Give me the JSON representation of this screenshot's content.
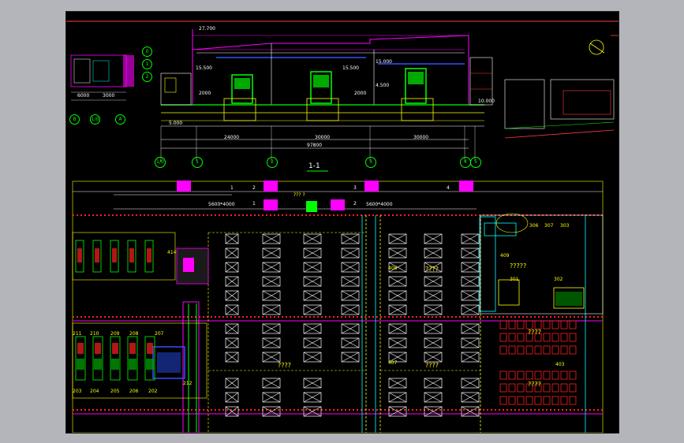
{
  "colors": {
    "background": "#000000",
    "frame": "#b3b5ba",
    "green": "#00ff00",
    "yellow": "#ffff00",
    "magenta": "#ff00ff",
    "cyan": "#00ffff",
    "red": "#ff2020",
    "white": "#ffffff",
    "blue": "#3050ff"
  },
  "section": {
    "title": "1-1",
    "dim_total": "97800",
    "dim_spans": [
      "24000",
      "30000",
      "30000"
    ],
    "top_dim": "27.700",
    "elev_left": "15.500",
    "elev_mid": "15.500",
    "elev_right": "15.000",
    "elev_low": "4.500",
    "grid_labels": [
      "1/0",
      "1",
      "2",
      "3",
      "4",
      "5"
    ],
    "right_mark": "10.000",
    "left_mark": "5.000",
    "aux_dim_a": "2000",
    "aux_dim_b": "2000"
  },
  "detail_left": {
    "dims": [
      "6000",
      "3000"
    ],
    "grid_labels": [
      "B",
      "1/0",
      "A"
    ],
    "circle_labels": [
      "0",
      "1",
      "2"
    ]
  },
  "plan": {
    "row_numbers": [
      "1",
      "2",
      "3",
      "4"
    ],
    "row2_numbers": [
      "1",
      "2"
    ],
    "top_dims": [
      "5600*4000",
      "5600*4000"
    ],
    "unknown_labels": [
      "????",
      "?????",
      "????",
      "????",
      "????",
      "????",
      "????",
      "????"
    ],
    "room_numbers": [
      "306",
      "307",
      "303",
      "301",
      "302",
      "409",
      "408",
      "407",
      "403"
    ],
    "left_room_numbers": [
      "414",
      "207",
      "208",
      "209",
      "210",
      "211",
      "205",
      "206",
      "204",
      "203",
      "202",
      "212"
    ],
    "top_tag": "??? ?"
  }
}
